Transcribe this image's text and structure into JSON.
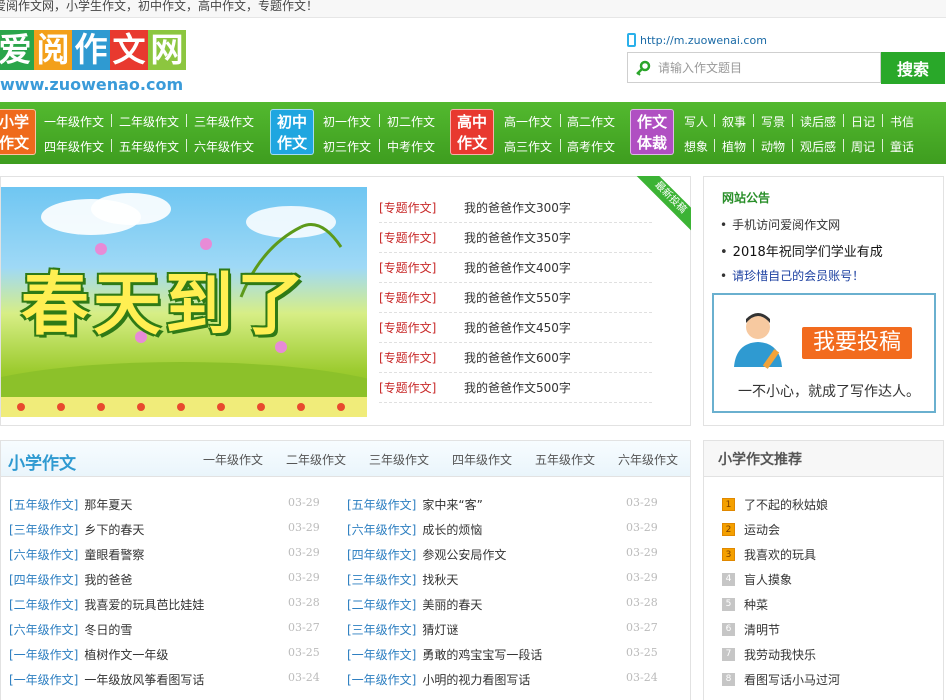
{
  "topbar": {
    "text": "爱阅作文网，小学生作文，初中作文，高中作文，专题作文！"
  },
  "logo": {
    "chars": [
      "爱",
      "阅",
      "作",
      "文",
      "网"
    ],
    "url": "www.zuowenao.com"
  },
  "header": {
    "mobile_url": "http://m.zuowenai.com",
    "search_placeholder": "请输入作文题目",
    "search_button": "搜索"
  },
  "nav": {
    "groups": [
      {
        "badge": "小学\n作文",
        "badge_color": "#ef6a1c",
        "row1": [
          "一年级作文",
          "二年级作文",
          "三年级作文"
        ],
        "row2": [
          "四年级作文",
          "五年级作文",
          "六年级作文"
        ]
      },
      {
        "badge": "初中\n作文",
        "badge_color": "#1fa6e0",
        "row1": [
          "初一作文",
          "初二作文"
        ],
        "row2": [
          "初三作文",
          "中考作文"
        ]
      },
      {
        "badge": "高中\n作文",
        "badge_color": "#e8392f",
        "row1": [
          "高一作文",
          "高二作文"
        ],
        "row2": [
          "高三作文",
          "高考作文"
        ]
      },
      {
        "badge": "作文\n体裁",
        "badge_color": "#b04fc2",
        "row1": [
          "写人",
          "叙事",
          "写景",
          "读后感",
          "日记",
          "书信"
        ],
        "row2": [
          "想象",
          "植物",
          "动物",
          "观后感",
          "周记",
          "童话"
        ]
      }
    ]
  },
  "featured": {
    "banner_text": "春天到了",
    "ribbon": "最新投稿",
    "items": [
      {
        "tag": "[专题作文]",
        "title": "我的爸爸作文300字"
      },
      {
        "tag": "[专题作文]",
        "title": "我的爸爸作文350字"
      },
      {
        "tag": "[专题作文]",
        "title": "我的爸爸作文400字"
      },
      {
        "tag": "[专题作文]",
        "title": "我的爸爸作文550字"
      },
      {
        "tag": "[专题作文]",
        "title": "我的爸爸作文450字"
      },
      {
        "tag": "[专题作文]",
        "title": "我的爸爸作文600字"
      },
      {
        "tag": "[专题作文]",
        "title": "我的爸爸作文500字"
      }
    ]
  },
  "notice": {
    "title": "网站公告",
    "items": [
      {
        "text": "手机访问爱阅作文网",
        "color": "#333333"
      },
      {
        "text": "2018年祝同学们学业有成",
        "color": "#111111"
      },
      {
        "text": "请珍惜自己的会员账号！",
        "color": "#1b3fa0"
      }
    ],
    "contribute_button": "我要投稿",
    "slogan": "一不小心，就成了写作达人。"
  },
  "primary": {
    "title": "小学作文",
    "tabs": [
      "一年级作文",
      "二年级作文",
      "三年级作文",
      "四年级作文",
      "五年级作文",
      "六年级作文"
    ],
    "left": [
      {
        "tag": "[五年级作文]",
        "title": "那年夏天",
        "date": "03-29"
      },
      {
        "tag": "[三年级作文]",
        "title": "乡下的春天",
        "date": "03-29"
      },
      {
        "tag": "[六年级作文]",
        "title": "童眼看警察",
        "date": "03-29"
      },
      {
        "tag": "[四年级作文]",
        "title": "我的爸爸",
        "date": "03-29"
      },
      {
        "tag": "[二年级作文]",
        "title": "我喜爱的玩具芭比娃娃",
        "date": "03-28"
      },
      {
        "tag": "[六年级作文]",
        "title": "冬日的雪",
        "date": "03-27"
      },
      {
        "tag": "[一年级作文]",
        "title": "植树作文一年级",
        "date": "03-25"
      },
      {
        "tag": "[一年级作文]",
        "title": "一年级放风筝看图写话",
        "date": "03-24"
      }
    ],
    "right": [
      {
        "tag": "[五年级作文]",
        "title": "家中来“客”",
        "date": "03-29"
      },
      {
        "tag": "[六年级作文]",
        "title": "成长的烦恼",
        "date": "03-29"
      },
      {
        "tag": "[四年级作文]",
        "title": "参观公安局作文",
        "date": "03-29"
      },
      {
        "tag": "[三年级作文]",
        "title": "找秋天",
        "date": "03-29"
      },
      {
        "tag": "[二年级作文]",
        "title": "美丽的春天",
        "date": "03-28"
      },
      {
        "tag": "[三年级作文]",
        "title": "猜灯谜",
        "date": "03-27"
      },
      {
        "tag": "[一年级作文]",
        "title": "勇敢的鸡宝宝写一段话",
        "date": "03-25"
      },
      {
        "tag": "[一年级作文]",
        "title": "小明的视力看图写话",
        "date": "03-24"
      }
    ]
  },
  "recommend": {
    "title": "小学作文推荐",
    "items": [
      "了不起的秋姑娘",
      "运动会",
      "我喜欢的玩具",
      "盲人摸象",
      "种菜",
      "清明节",
      "我劳动我快乐",
      "看图写话小马过河"
    ]
  }
}
